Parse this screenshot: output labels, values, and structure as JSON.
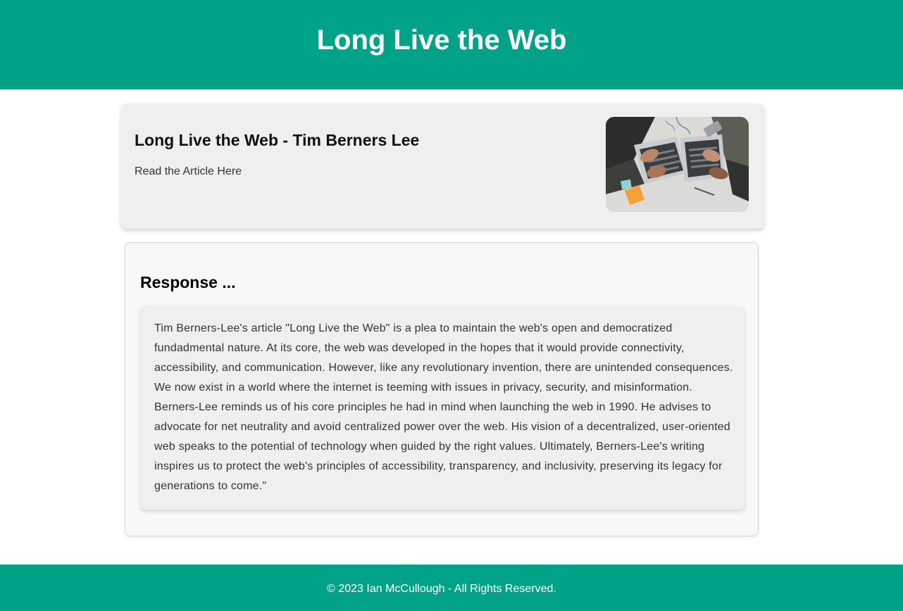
{
  "header": {
    "title": "Long Live the Web"
  },
  "article": {
    "title": "Long Live the Web - Tim Berners Lee",
    "link_label": "Read the Article Here",
    "image_icon": "laptops-photo"
  },
  "response": {
    "heading": "Response ...",
    "body": "Tim Berners-Lee's article \"Long Live the Web\" is a plea to maintain the web's open and democratized fundadmental nature. At its core, the web was developed in the hopes that it would provide connectivity, accessibility, and communication. However, like any revolutionary invention, there are unintended consequences. We now exist in a world where the internet is teeming with issues in privacy, security, and misinformation. Berners-Lee reminds us of his core principles he had in mind when launching the web in 1990. He advises to advocate for net neutrality and avoid centralized power over the web. His vision of a decentralized, user-oriented web speaks to the potential of technology when guided by the right values. Ultimately, Berners-Lee's writing inspires us to protect the web's principles of accessibility, transparency, and inclusivity, preserving its legacy for generations to come.\""
  },
  "footer": {
    "text": "© 2023 Ian McCullough - All Rights Reserved."
  },
  "colors": {
    "accent": "#00a388",
    "card_bg": "#efefef",
    "section_bg": "#f8f8f8"
  }
}
